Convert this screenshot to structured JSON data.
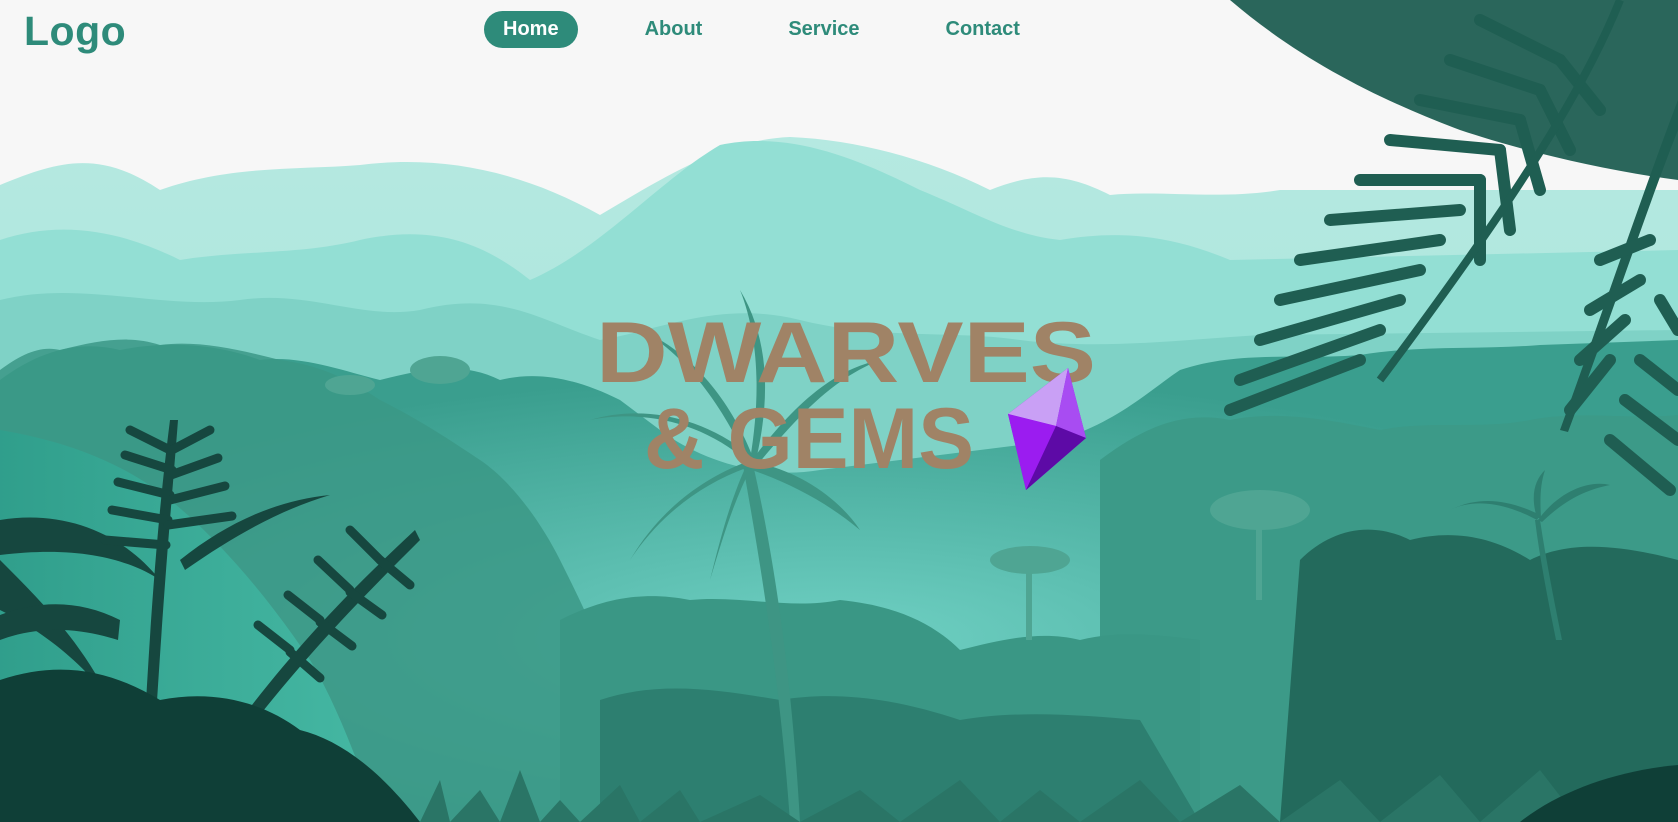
{
  "header": {
    "logo_text": "Logo",
    "nav": [
      {
        "label": "Home",
        "active": true
      },
      {
        "label": "About",
        "active": false
      },
      {
        "label": "Service",
        "active": false
      },
      {
        "label": "Contact",
        "active": false
      }
    ]
  },
  "hero": {
    "title_line1": "DWARVES",
    "title_line2": "& GEMS",
    "title_color": "#a08366",
    "gem_icon": "purple-gem-icon"
  },
  "colors": {
    "accent": "#2e8b7a",
    "page_background": "#f7f7f7",
    "gem": "#9b1cf0"
  }
}
